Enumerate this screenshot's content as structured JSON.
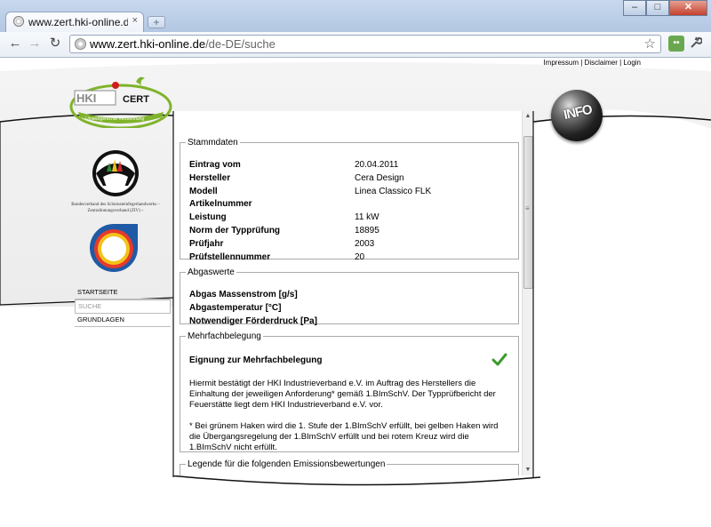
{
  "browser": {
    "tab_title": "www.zert.hki-online.de/de",
    "tab_close": "×",
    "new_tab": "+",
    "url_host": "www.zert.hki-online.de",
    "url_path": "/de-DE/suche",
    "window_buttons": {
      "minimize": "–",
      "maximize": "□",
      "close": "✕"
    },
    "nav": {
      "back": "←",
      "forward": "→",
      "reload": "↻"
    },
    "star": "☆",
    "wrench": "🔧",
    "ext_label": "••"
  },
  "header": {
    "links": [
      "Impressum",
      "Disclaimer",
      "Login"
    ],
    "separator": " | "
  },
  "logos": {
    "hki_text": "CERT",
    "hki_tagline": "Umweltgerechte Verbrennung",
    "schorn_caption": "Bundesverband des Schornsteinfegerhandwerks – Zentralinnungsverband (ZIV) –",
    "info_text": "INFO"
  },
  "sidenav": {
    "items": [
      {
        "label": "STARTSEITE",
        "active": false
      },
      {
        "label": "SUCHE",
        "active": true
      },
      {
        "label": "GRUNDLAGEN",
        "active": false
      }
    ]
  },
  "stammdaten": {
    "legend": "Stammdaten",
    "rows": [
      {
        "label": "Eintrag vom",
        "value": "20.04.2011"
      },
      {
        "label": "Hersteller",
        "value": "Cera Design"
      },
      {
        "label": "Modell",
        "value": "Linea Classico FLK"
      },
      {
        "label": "Artikelnummer",
        "value": ""
      },
      {
        "label": "Leistung",
        "value": "11 kW"
      },
      {
        "label": "Norm der Typprüfung",
        "value": "18895"
      },
      {
        "label": "Prüfjahr",
        "value": "2003"
      },
      {
        "label": "Prüfstellennummer",
        "value": "20"
      }
    ]
  },
  "abgaswerte": {
    "legend": "Abgaswerte",
    "rows": [
      {
        "label": "Abgas Massenstrom [g/s]",
        "value": ""
      },
      {
        "label": "Abgastemperatur [°C]",
        "value": ""
      },
      {
        "label": "Notwendiger Förderdruck [Pa]",
        "value": ""
      }
    ]
  },
  "mehrfachbelegung": {
    "legend": "Mehrfachbelegung",
    "title": "Eignung zur Mehrfachbelegung",
    "check_color": "#3a9a2a",
    "paragraph1": "Hiermit bestätigt der HKI Industrieverband e.V. im Auftrag des Herstellers die Einhaltung der jeweiligen Anforderung* gemäß 1.BImSchV. Der Typprüfbericht der Feuerstätte liegt dem HKI Industrieverband e.V. vor.",
    "paragraph2": "* Bei grünem Haken wird die 1. Stufe der 1.BImSchV erfüllt, bei gelben Haken wird die Übergangsregelung der 1.BImSchV erfüllt und bei rotem Kreuz wird die 1.BImSchV nicht erfüllt."
  },
  "legende": {
    "legend": "Legende für die folgenden Emissionsbewertungen"
  },
  "scrollbar": {
    "up": "▲",
    "down": "▼",
    "grip": "≡"
  },
  "colors": {
    "accent_green": "#7fb32a",
    "hki_blue": "#1f5aa6"
  }
}
